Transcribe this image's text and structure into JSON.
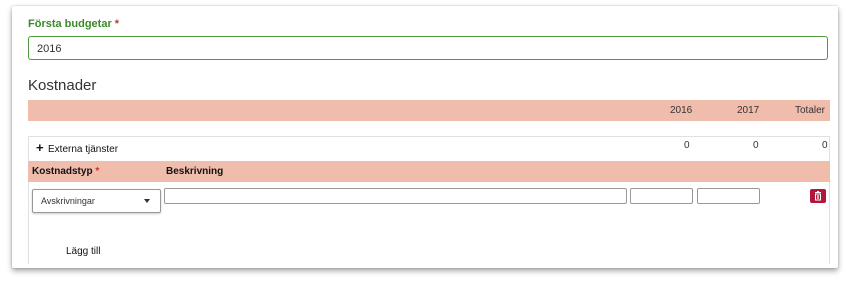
{
  "form": {
    "first_budget_label": "Första budgetar",
    "required_mark": "*",
    "first_budget_value": "2016"
  },
  "costs": {
    "title": "Kostnader",
    "columns": [
      "2016",
      "2017",
      "Totaler"
    ],
    "group": {
      "label": "Externa tjänster",
      "totals": [
        "0",
        "0",
        "0"
      ]
    },
    "sub_headers": {
      "type": "Kostnadstyp",
      "description": "Beskrivning"
    },
    "row": {
      "type_value": "Avskrivningar",
      "description_value": "",
      "value_2016": "",
      "value_2017": ""
    },
    "add_label": "Lägg till"
  },
  "colors": {
    "accent_green": "#3b8a2a",
    "header_band": "#f0bcac",
    "delete_button": "#b0173a",
    "required": "#c0392b"
  },
  "icons": {
    "expand": "plus-icon",
    "dropdown": "chevron-down-icon",
    "delete": "trash-icon"
  }
}
